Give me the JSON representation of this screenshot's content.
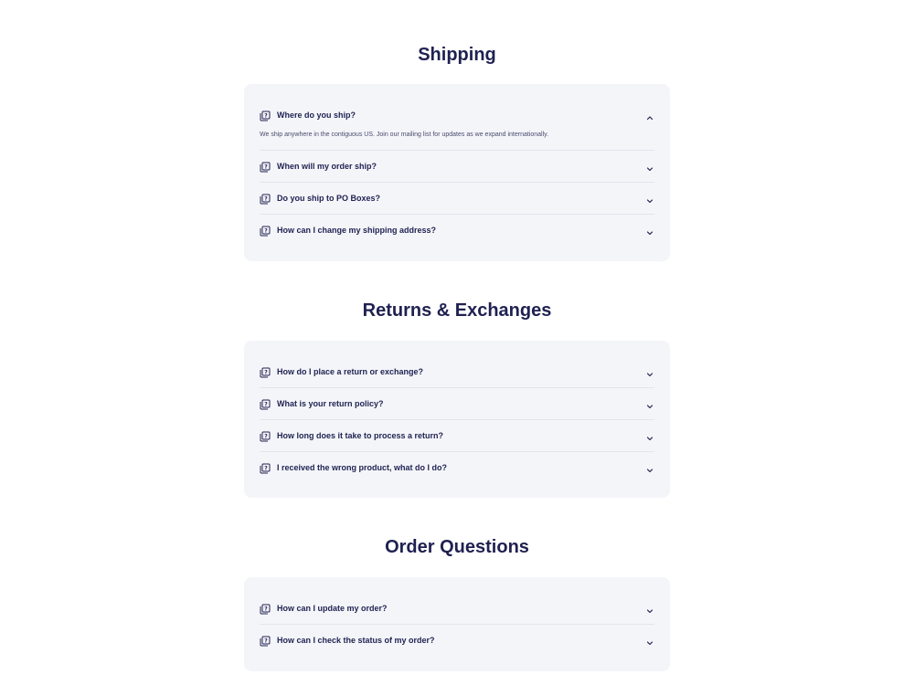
{
  "sections": [
    {
      "title": "Shipping",
      "items": [
        {
          "question": "Where do you ship?",
          "answer": "We ship anywhere in the contiguous US. Join our mailing list for updates as we expand internationally.",
          "expanded": true
        },
        {
          "question": "When will my order ship?",
          "expanded": false
        },
        {
          "question": "Do you ship to PO Boxes?",
          "expanded": false
        },
        {
          "question": "How can I change my shipping address?",
          "expanded": false
        }
      ]
    },
    {
      "title": "Returns & Exchanges",
      "items": [
        {
          "question": "How do I place a return or exchange?",
          "expanded": false
        },
        {
          "question": "What is your return policy?",
          "expanded": false
        },
        {
          "question": "How long does it take to process a return?",
          "expanded": false
        },
        {
          "question": "I received the wrong product, what do I do?",
          "expanded": false
        }
      ]
    },
    {
      "title": "Order Questions",
      "items": [
        {
          "question": "How can I update my order?",
          "expanded": false
        },
        {
          "question": "How can I check the status of my order?",
          "expanded": false
        }
      ]
    }
  ],
  "icons": {
    "question": "question-cards-icon",
    "expanded": "chevron-up-icon",
    "collapsed": "chevron-down-icon"
  },
  "colors": {
    "text": "#1f2151",
    "card_bg": "#f4f5f9",
    "divider": "#e3e4ec"
  }
}
